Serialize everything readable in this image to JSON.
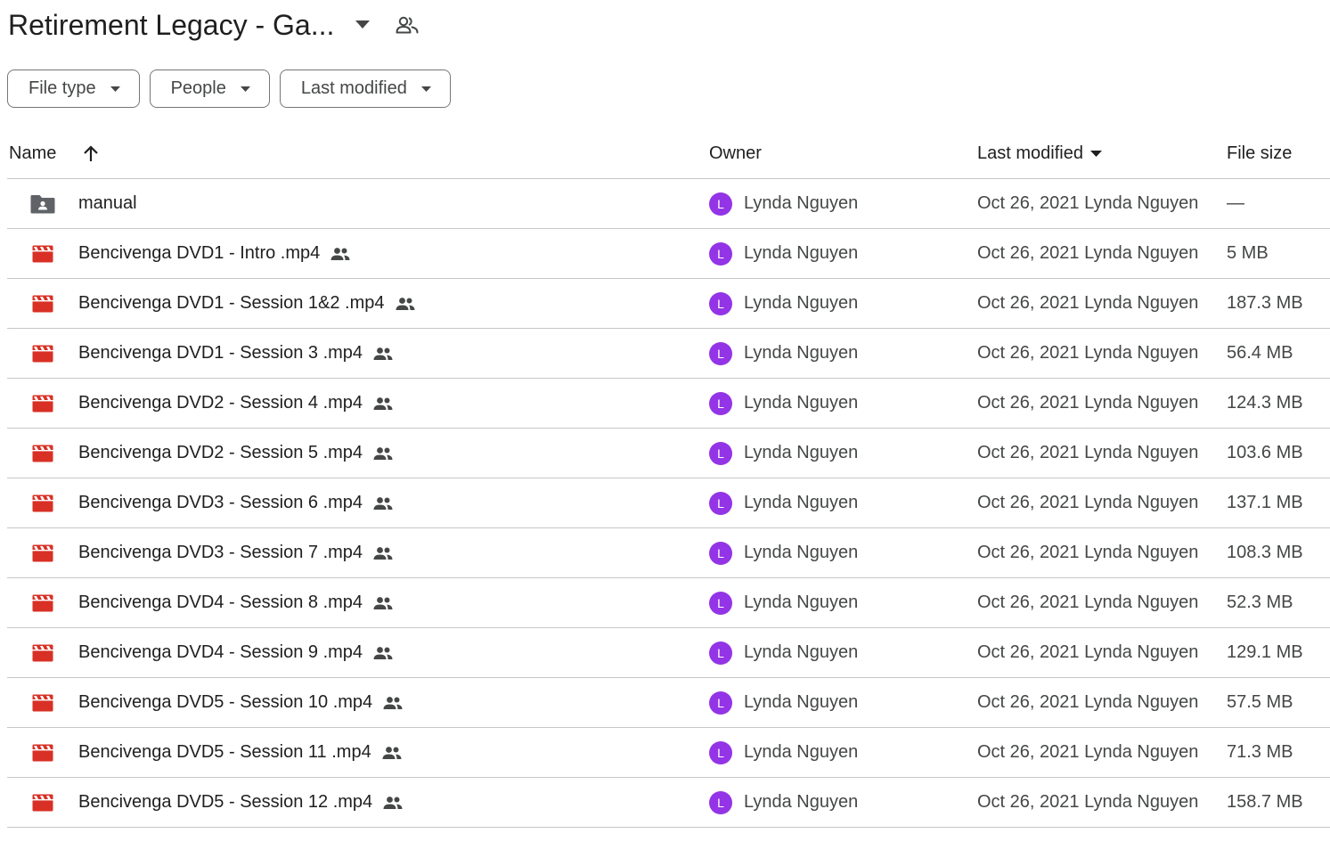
{
  "header": {
    "title": "Retirement Legacy - Ga...",
    "title_caret_icon": "arrow-drop-down-icon",
    "shared_icon": "people-outline-icon"
  },
  "filters": [
    {
      "label": "File type"
    },
    {
      "label": "People"
    },
    {
      "label": "Last modified"
    }
  ],
  "columns": {
    "name": "Name",
    "owner": "Owner",
    "last_modified": "Last modified",
    "file_size": "File size"
  },
  "colors": {
    "video_icon": "#d93025",
    "folder_icon": "#5f6368",
    "avatar": "#9334e6",
    "divider": "#c7c7c7"
  },
  "files": [
    {
      "name": "manual",
      "type": "folder",
      "shared": false,
      "owner": "Lynda Nguyen",
      "avatar_letter": "L",
      "modified": "Oct 26, 2021 Lynda Nguyen",
      "size": "—"
    },
    {
      "name": "Bencivenga DVD1 - Intro .mp4",
      "type": "video",
      "shared": true,
      "owner": "Lynda Nguyen",
      "avatar_letter": "L",
      "modified": "Oct 26, 2021 Lynda Nguyen",
      "size": "5 MB"
    },
    {
      "name": "Bencivenga DVD1 - Session 1&2 .mp4",
      "type": "video",
      "shared": true,
      "owner": "Lynda Nguyen",
      "avatar_letter": "L",
      "modified": "Oct 26, 2021 Lynda Nguyen",
      "size": "187.3 MB"
    },
    {
      "name": "Bencivenga DVD1 - Session 3 .mp4",
      "type": "video",
      "shared": true,
      "owner": "Lynda Nguyen",
      "avatar_letter": "L",
      "modified": "Oct 26, 2021 Lynda Nguyen",
      "size": "56.4 MB"
    },
    {
      "name": "Bencivenga DVD2 - Session 4 .mp4",
      "type": "video",
      "shared": true,
      "owner": "Lynda Nguyen",
      "avatar_letter": "L",
      "modified": "Oct 26, 2021 Lynda Nguyen",
      "size": "124.3 MB"
    },
    {
      "name": "Bencivenga DVD2 - Session 5 .mp4",
      "type": "video",
      "shared": true,
      "owner": "Lynda Nguyen",
      "avatar_letter": "L",
      "modified": "Oct 26, 2021 Lynda Nguyen",
      "size": "103.6 MB"
    },
    {
      "name": "Bencivenga DVD3 - Session 6 .mp4",
      "type": "video",
      "shared": true,
      "owner": "Lynda Nguyen",
      "avatar_letter": "L",
      "modified": "Oct 26, 2021 Lynda Nguyen",
      "size": "137.1 MB"
    },
    {
      "name": "Bencivenga DVD3 - Session 7 .mp4",
      "type": "video",
      "shared": true,
      "owner": "Lynda Nguyen",
      "avatar_letter": "L",
      "modified": "Oct 26, 2021 Lynda Nguyen",
      "size": "108.3 MB"
    },
    {
      "name": "Bencivenga DVD4 - Session 8 .mp4",
      "type": "video",
      "shared": true,
      "owner": "Lynda Nguyen",
      "avatar_letter": "L",
      "modified": "Oct 26, 2021 Lynda Nguyen",
      "size": "52.3 MB"
    },
    {
      "name": "Bencivenga DVD4 - Session 9 .mp4",
      "type": "video",
      "shared": true,
      "owner": "Lynda Nguyen",
      "avatar_letter": "L",
      "modified": "Oct 26, 2021 Lynda Nguyen",
      "size": "129.1 MB"
    },
    {
      "name": "Bencivenga DVD5 - Session 10 .mp4",
      "type": "video",
      "shared": true,
      "owner": "Lynda Nguyen",
      "avatar_letter": "L",
      "modified": "Oct 26, 2021 Lynda Nguyen",
      "size": "57.5 MB"
    },
    {
      "name": "Bencivenga DVD5 - Session 11 .mp4",
      "type": "video",
      "shared": true,
      "owner": "Lynda Nguyen",
      "avatar_letter": "L",
      "modified": "Oct 26, 2021 Lynda Nguyen",
      "size": "71.3 MB"
    },
    {
      "name": "Bencivenga DVD5 - Session 12 .mp4",
      "type": "video",
      "shared": true,
      "owner": "Lynda Nguyen",
      "avatar_letter": "L",
      "modified": "Oct 26, 2021 Lynda Nguyen",
      "size": "158.7 MB"
    }
  ]
}
